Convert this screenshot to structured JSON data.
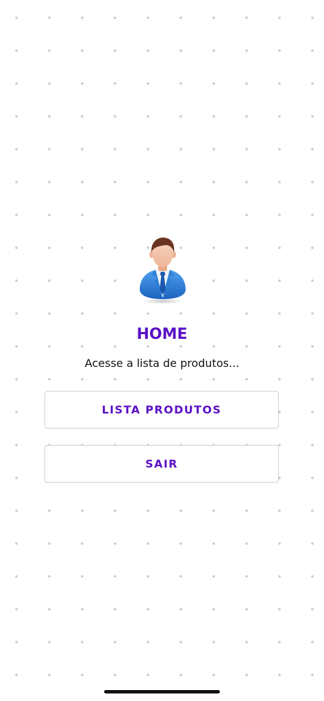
{
  "home": {
    "title": "HOME",
    "subtitle": "Acesse a lista de produtos...",
    "avatar_icon": "businessman-avatar-icon"
  },
  "buttons": {
    "lista_produtos": "LISTA PRODUTOS",
    "sair": "SAIR"
  },
  "colors": {
    "accent": "#5A10C6",
    "background": "#FFFFFF",
    "dot_grid": "#C9C9C9",
    "button_border": "#CFCFCF",
    "suit_blue": "#2F7FD6"
  }
}
